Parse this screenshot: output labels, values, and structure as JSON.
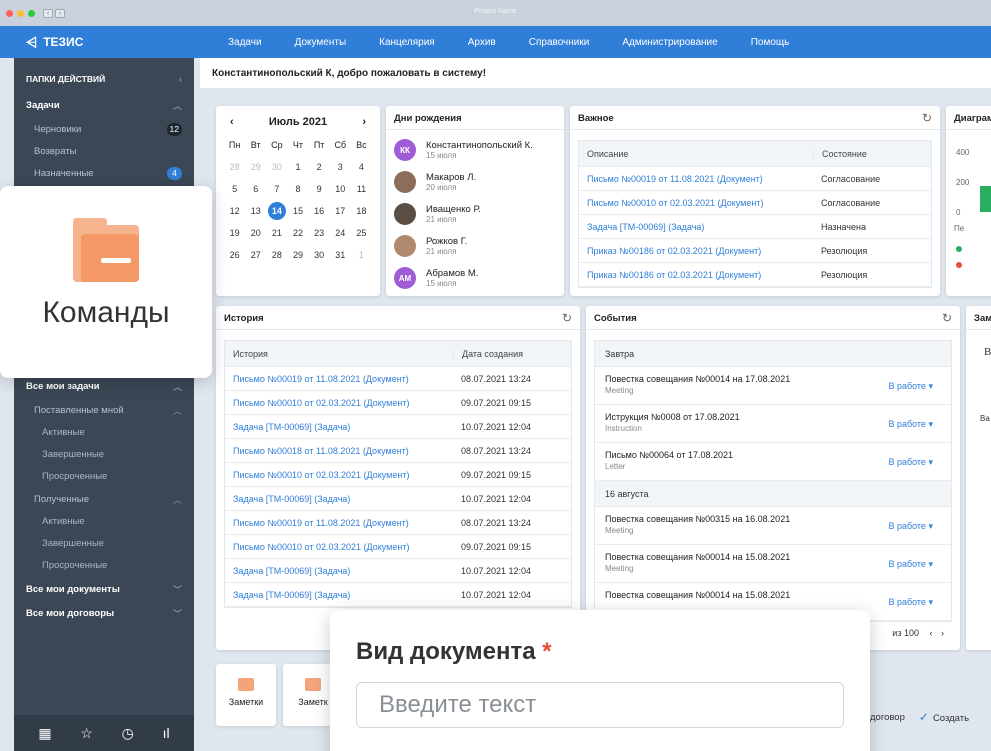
{
  "window": {
    "title": "Project Name",
    "dot_colors": [
      "#ff5f56",
      "#ffbd2e",
      "#27c93f"
    ]
  },
  "header": {
    "logo": "ТЕЗИС",
    "nav": [
      "Задачи",
      "Документы",
      "Канцелярия",
      "Архив",
      "Справочники",
      "Администрирование",
      "Помощь"
    ]
  },
  "sidebar": {
    "section_title": "ПАПКИ ДЕЙСТВИЙ",
    "tasks_title": "Задачи",
    "tasks_items": [
      {
        "label": "Черновики",
        "badge": "12"
      },
      {
        "label": "Возвраты",
        "badge": ""
      },
      {
        "label": "Назначенные",
        "badge": "4"
      }
    ],
    "all_tasks": "Все мои задачи",
    "set_by_me": "Поставленные мной",
    "set_by_me_items": [
      "Активные",
      "Завершенные",
      "Просроченные"
    ],
    "received": "Полученные",
    "received_items": [
      "Активные",
      "Завершенные",
      "Просроченные"
    ],
    "all_docs": "Все мои документы",
    "all_contracts": "Все мои договоры"
  },
  "greeting": "Константинопольский К, добро пожаловать в систему!",
  "calendar": {
    "month": "Июль 2021",
    "dows": [
      "Пн",
      "Вт",
      "Ср",
      "Чт",
      "Пт",
      "Сб",
      "Вс"
    ],
    "today": "14",
    "rows": [
      [
        "28",
        "29",
        "30",
        "1",
        "2",
        "3",
        "4"
      ],
      [
        "5",
        "6",
        "7",
        "8",
        "9",
        "10",
        "11"
      ],
      [
        "12",
        "13",
        "14",
        "15",
        "16",
        "17",
        "18"
      ],
      [
        "19",
        "20",
        "21",
        "22",
        "23",
        "24",
        "25"
      ],
      [
        "26",
        "27",
        "28",
        "29",
        "30",
        "31",
        "1"
      ]
    ]
  },
  "birthdays": {
    "title": "Дни рождения",
    "people": [
      {
        "initials": "КК",
        "name": "Константинопольский К.",
        "date": "15 июля",
        "color": "#a05bd6"
      },
      {
        "initials": "",
        "name": "Макаров Л.",
        "date": "20 июля",
        "color": "#8a6d5a"
      },
      {
        "initials": "",
        "name": "Иващенко Р.",
        "date": "21 июля",
        "color": "#5a4d44"
      },
      {
        "initials": "",
        "name": "Рожков Г.",
        "date": "21 июля",
        "color": "#b08a6e"
      },
      {
        "initials": "АМ",
        "name": "Абрамов М.",
        "date": "15 июля",
        "color": "#a05bd6"
      }
    ]
  },
  "important": {
    "title": "Важное",
    "col_desc": "Описание",
    "col_state": "Состояние",
    "rows": [
      {
        "desc": "Письмо №00019 от 11.08.2021 (Документ)",
        "state": "Согласование"
      },
      {
        "desc": "Письмо №00010 от 02.03.2021 (Документ)",
        "state": "Согласование"
      },
      {
        "desc": "Задача [ТМ-00069] (Задача)",
        "state": "Назначена"
      },
      {
        "desc": "Приказ №00186 от 02.03.2021 (Документ)",
        "state": "Резолюция"
      },
      {
        "desc": "Приказ №00186 от 02.03.2021 (Документ)",
        "state": "Резолюция"
      }
    ]
  },
  "diagram": {
    "title": "Диаграм",
    "ticks": [
      "400",
      "200",
      "0"
    ],
    "label": "Пе"
  },
  "history": {
    "title": "История",
    "col_hist": "История",
    "col_date": "Дата создания",
    "rows": [
      {
        "text": "Письмо №00019 от 11.08.2021 (Документ)",
        "date": "08.07.2021  13:24"
      },
      {
        "text": "Письмо №00010 от 02.03.2021 (Документ)",
        "date": "09.07.2021  09:15"
      },
      {
        "text": "Задача [ТМ-00069] (Задача)",
        "date": "10.07.2021  12:04"
      },
      {
        "text": "Письмо №00018 от 11.08.2021 (Документ)",
        "date": "08.07.2021  13:24"
      },
      {
        "text": "Письмо №00010 от 02.03.2021 (Документ)",
        "date": "09.07.2021  09:15"
      },
      {
        "text": "Задача [ТМ-00069] (Задача)",
        "date": "10.07.2021  12:04"
      },
      {
        "text": "Письмо №00019 от 11.08.2021 (Документ)",
        "date": "08.07.2021  13:24"
      },
      {
        "text": "Письмо №00010 от 02.03.2021 (Документ)",
        "date": "09.07.2021  09:15"
      },
      {
        "text": "Задача [ТМ-00069] (Задача)",
        "date": "10.07.2021  12:04"
      },
      {
        "text": "Задача [ТМ-00069] (Задача)",
        "date": "10.07.2021  12:04"
      }
    ]
  },
  "events": {
    "title": "События",
    "group1": "Завтра",
    "group2": "16 августа",
    "status": "В работе",
    "g1_rows": [
      {
        "title": "Повестка совещания №00014 на 17.08.2021",
        "sub": "Meeting"
      },
      {
        "title": "Иструкция №0008 от 17.08.2021",
        "sub": "Instruction"
      },
      {
        "title": "Письмо №00064 от 17.08.2021",
        "sub": "Letter"
      }
    ],
    "g2_rows": [
      {
        "title": "Повестка совещания №00315 на 16.08.2021",
        "sub": "Meeting"
      },
      {
        "title": "Повестка совещания №00014 на 15.08.2021",
        "sub": "Meeting"
      },
      {
        "title": "Повестка совещания №00014 на 15.08.2021",
        "sub": ""
      }
    ],
    "pager": "из 100"
  },
  "notes_panel": {
    "title": "Зам",
    "letter": "В",
    "text": "Ва"
  },
  "tiles": [
    "Заметки",
    "Заметк"
  ],
  "overlay_command": {
    "label": "Команды"
  },
  "overlay_doc": {
    "label": "Вид документа",
    "required_mark": "*",
    "placeholder": "Введите текст"
  },
  "bottom_actions": {
    "contract": "договор",
    "create": "Создать"
  }
}
